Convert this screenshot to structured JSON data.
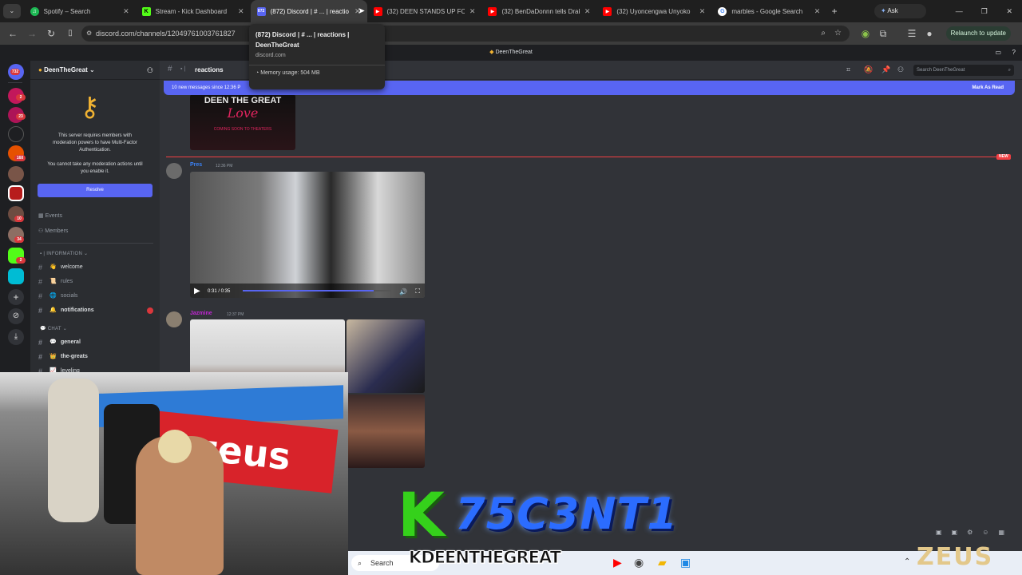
{
  "browser": {
    "tabs": [
      {
        "title": "Spotify – Search",
        "color": "#1db954",
        "glyph": "♫"
      },
      {
        "title": "Stream - Kick Dashboard",
        "color": "#53fc18",
        "glyph": "K"
      },
      {
        "title": "(872) Discord | # ... | reactio",
        "color": "#5865f2",
        "glyph": "872",
        "active": true
      },
      {
        "title": "(32) DEEN STANDS UP FOR",
        "color": "#ff0000",
        "glyph": "▶"
      },
      {
        "title": "(32) BenDaDonnn tells Drak",
        "color": "#ff0000",
        "glyph": "▶"
      },
      {
        "title": "(32) Uyoncengwa Unyoko",
        "color": "#ff0000",
        "glyph": "▶"
      },
      {
        "title": "marbles - Google Search",
        "color": "#4285f4",
        "glyph": "G"
      }
    ],
    "ask_gemini": "Ask Gemini",
    "url": "discord.com/channels/1204976100376182​7",
    "relaunch": "Relaunch to update",
    "tooltip": {
      "title_line1": "(872) Discord | # ... | reactions |",
      "title_line2": "DeenTheGreat",
      "domain": "discord.com",
      "memory": "Memory usage: 504 MB"
    }
  },
  "discord": {
    "window_title": "DeenTheGreat",
    "server_name": "DeenTheGreat",
    "mfa": {
      "line1": "This server requires members with",
      "line2": "moderation powers to have Multi-Factor",
      "line3": "Authentication.",
      "line4": "You cannot take any moderation actions until",
      "line5": "you enable it.",
      "resolve": "Resolve"
    },
    "nav": {
      "events": "Events",
      "members": "Members"
    },
    "categories": {
      "information": "| INFORMATION ⌄",
      "chat": "CHAT ⌄"
    },
    "channels": {
      "welcome": "welcome",
      "rules": "rules",
      "socials": "socials",
      "notifications": "notifications",
      "general": "general",
      "the_greats": "the-greats",
      "leveling": "leveling"
    },
    "header": {
      "channel": "reactions",
      "search_placeholder": "Search DeenTheGreat"
    },
    "new_messages": "10 new messages since 12:36 P",
    "mark_as_read": "Mark As Read",
    "new_label": "NEW",
    "poster": {
      "line1": "DEEN THE GREAT",
      "line2": "Love",
      "line3": "COMING SOON TO THEATERS"
    },
    "messages": [
      {
        "author": "Pres",
        "time": "12:36 PM",
        "color": "#3b82f6"
      },
      {
        "author": "Jazmine",
        "time": "12:37 PM",
        "color": "#c026d3"
      }
    ],
    "video": {
      "time": "0:31 / 0:35"
    }
  },
  "overlay": {
    "k": "K",
    "code": "75C3NT1",
    "name": "KDEENTHEGREAT",
    "logo": "ZEUS",
    "banner": "zeus"
  },
  "taskbar": {
    "search": "Search"
  },
  "guild_badges": [
    "732",
    "2",
    "23",
    "160",
    "10",
    "34",
    "2"
  ]
}
